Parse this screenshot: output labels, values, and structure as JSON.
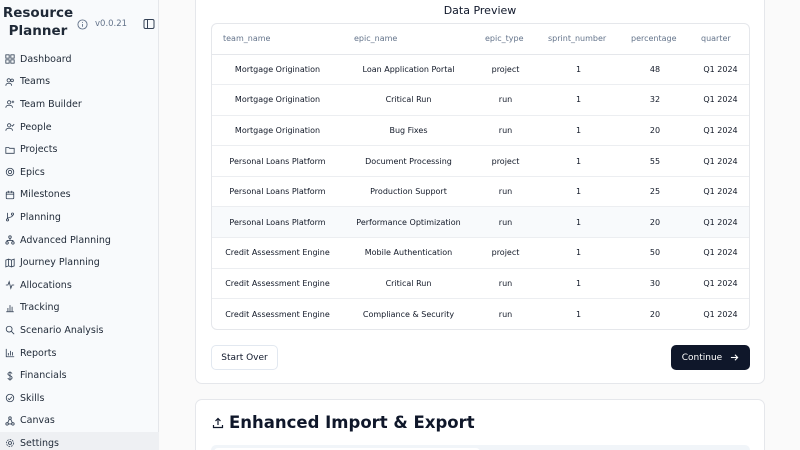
{
  "app": {
    "title_line1": "Resource",
    "title_line2": "Planner",
    "version": "v0.0.21"
  },
  "nav": [
    {
      "label": "Dashboard",
      "icon": "dashboard-icon"
    },
    {
      "label": "Teams",
      "icon": "users-icon"
    },
    {
      "label": "Team Builder",
      "icon": "user-plus-icon"
    },
    {
      "label": "People",
      "icon": "user-check-icon"
    },
    {
      "label": "Projects",
      "icon": "folder-icon"
    },
    {
      "label": "Epics",
      "icon": "target-icon"
    },
    {
      "label": "Milestones",
      "icon": "calendar-icon"
    },
    {
      "label": "Planning",
      "icon": "git-branch-icon"
    },
    {
      "label": "Advanced Planning",
      "icon": "network-icon"
    },
    {
      "label": "Journey Planning",
      "icon": "map-icon"
    },
    {
      "label": "Allocations",
      "icon": "activity-icon"
    },
    {
      "label": "Tracking",
      "icon": "bar-chart-icon"
    },
    {
      "label": "Scenario Analysis",
      "icon": "search-icon"
    },
    {
      "label": "Reports",
      "icon": "chart-icon"
    },
    {
      "label": "Financials",
      "icon": "dollar-icon"
    },
    {
      "label": "Skills",
      "icon": "award-icon"
    },
    {
      "label": "Canvas",
      "icon": "canvas-icon"
    },
    {
      "label": "Settings",
      "icon": "gear-icon"
    }
  ],
  "preview": {
    "title": "Data Preview",
    "columns": [
      "team_name",
      "epic_name",
      "epic_type",
      "sprint_number",
      "percentage",
      "quarter"
    ],
    "rows": [
      [
        "Mortgage Origination",
        "Loan Application Portal",
        "project",
        "1",
        "48",
        "Q1 2024"
      ],
      [
        "Mortgage Origination",
        "Critical Run",
        "run",
        "1",
        "32",
        "Q1 2024"
      ],
      [
        "Mortgage Origination",
        "Bug Fixes",
        "run",
        "1",
        "20",
        "Q1 2024"
      ],
      [
        "Personal Loans Platform",
        "Document Processing",
        "project",
        "1",
        "55",
        "Q1 2024"
      ],
      [
        "Personal Loans Platform",
        "Production Support",
        "run",
        "1",
        "25",
        "Q1 2024"
      ],
      [
        "Personal Loans Platform",
        "Performance Optimization",
        "run",
        "1",
        "20",
        "Q1 2024"
      ],
      [
        "Credit Assessment Engine",
        "Mobile Authentication",
        "project",
        "1",
        "50",
        "Q1 2024"
      ],
      [
        "Credit Assessment Engine",
        "Critical Run",
        "run",
        "1",
        "30",
        "Q1 2024"
      ],
      [
        "Credit Assessment Engine",
        "Compliance & Security",
        "run",
        "1",
        "20",
        "Q1 2024"
      ]
    ],
    "start_over_label": "Start Over",
    "continue_label": "Continue"
  },
  "import_export": {
    "title": "Enhanced Import & Export"
  },
  "colors": {
    "primary": "#0f172a",
    "sidebar_bg": "#f8fafc",
    "active_item": "#eef0f3"
  }
}
